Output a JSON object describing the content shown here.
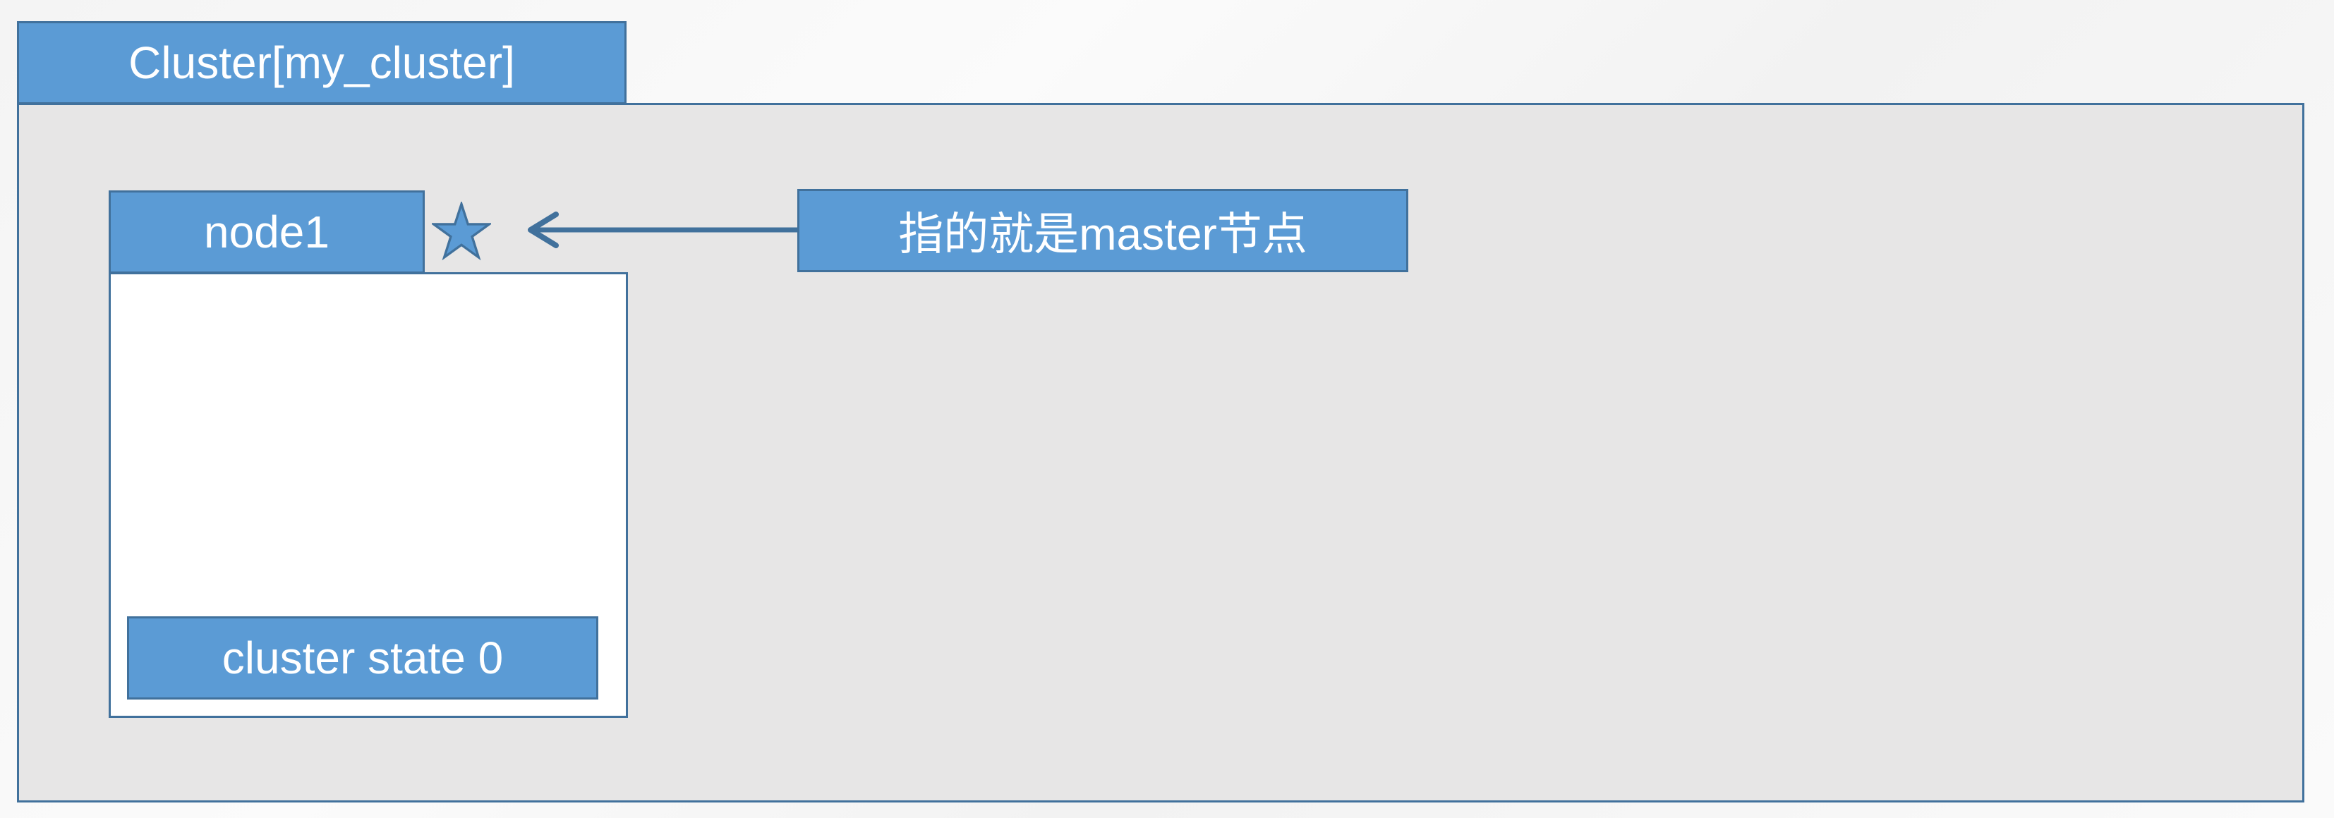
{
  "cluster": {
    "title": "Cluster[my_cluster]"
  },
  "node": {
    "title": "node1",
    "state_label": "cluster state 0",
    "master_marker_icon": "star-icon"
  },
  "annotation": {
    "text": "指的就是master节点",
    "arrow_icon": "arrow-left-icon"
  },
  "colors": {
    "box_fill": "#5b9bd5",
    "box_border": "#41719c",
    "cluster_fill": "#e7e6e6",
    "node_fill": "#ffffff",
    "text": "#ffffff"
  }
}
